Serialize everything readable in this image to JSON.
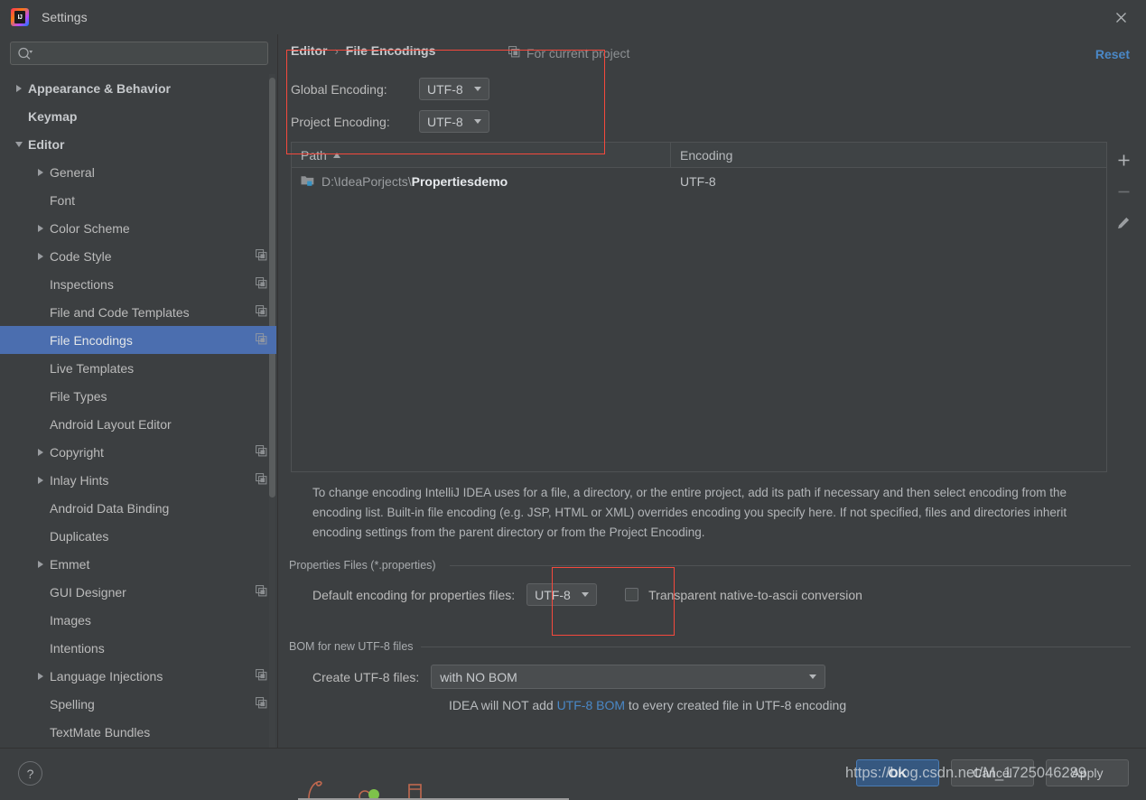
{
  "window": {
    "title": "Settings",
    "logo_icon": "intellij-idea-logo",
    "close_icon": "close-icon"
  },
  "search": {
    "value": "",
    "placeholder": "",
    "icon": "search-icon"
  },
  "sidebar": {
    "items": [
      {
        "label": "Appearance & Behavior",
        "indent": 0,
        "arrow": "right",
        "bold": true,
        "copy": false,
        "selected": false
      },
      {
        "label": "Keymap",
        "indent": 0,
        "arrow": "none",
        "bold": true,
        "copy": false,
        "selected": false
      },
      {
        "label": "Editor",
        "indent": 0,
        "arrow": "down",
        "bold": true,
        "copy": false,
        "selected": false
      },
      {
        "label": "General",
        "indent": 1,
        "arrow": "right",
        "bold": false,
        "copy": false,
        "selected": false
      },
      {
        "label": "Font",
        "indent": 1,
        "arrow": "none",
        "bold": false,
        "copy": false,
        "selected": false
      },
      {
        "label": "Color Scheme",
        "indent": 1,
        "arrow": "right",
        "bold": false,
        "copy": false,
        "selected": false
      },
      {
        "label": "Code Style",
        "indent": 1,
        "arrow": "right",
        "bold": false,
        "copy": true,
        "selected": false
      },
      {
        "label": "Inspections",
        "indent": 1,
        "arrow": "none",
        "bold": false,
        "copy": true,
        "selected": false
      },
      {
        "label": "File and Code Templates",
        "indent": 1,
        "arrow": "none",
        "bold": false,
        "copy": true,
        "selected": false
      },
      {
        "label": "File Encodings",
        "indent": 1,
        "arrow": "none",
        "bold": false,
        "copy": true,
        "selected": true
      },
      {
        "label": "Live Templates",
        "indent": 1,
        "arrow": "none",
        "bold": false,
        "copy": false,
        "selected": false
      },
      {
        "label": "File Types",
        "indent": 1,
        "arrow": "none",
        "bold": false,
        "copy": false,
        "selected": false
      },
      {
        "label": "Android Layout Editor",
        "indent": 1,
        "arrow": "none",
        "bold": false,
        "copy": false,
        "selected": false
      },
      {
        "label": "Copyright",
        "indent": 1,
        "arrow": "right",
        "bold": false,
        "copy": true,
        "selected": false
      },
      {
        "label": "Inlay Hints",
        "indent": 1,
        "arrow": "right",
        "bold": false,
        "copy": true,
        "selected": false
      },
      {
        "label": "Android Data Binding",
        "indent": 1,
        "arrow": "none",
        "bold": false,
        "copy": false,
        "selected": false
      },
      {
        "label": "Duplicates",
        "indent": 1,
        "arrow": "none",
        "bold": false,
        "copy": false,
        "selected": false
      },
      {
        "label": "Emmet",
        "indent": 1,
        "arrow": "right",
        "bold": false,
        "copy": false,
        "selected": false
      },
      {
        "label": "GUI Designer",
        "indent": 1,
        "arrow": "none",
        "bold": false,
        "copy": true,
        "selected": false
      },
      {
        "label": "Images",
        "indent": 1,
        "arrow": "none",
        "bold": false,
        "copy": false,
        "selected": false
      },
      {
        "label": "Intentions",
        "indent": 1,
        "arrow": "none",
        "bold": false,
        "copy": false,
        "selected": false
      },
      {
        "label": "Language Injections",
        "indent": 1,
        "arrow": "right",
        "bold": false,
        "copy": true,
        "selected": false
      },
      {
        "label": "Spelling",
        "indent": 1,
        "arrow": "none",
        "bold": false,
        "copy": true,
        "selected": false
      },
      {
        "label": "TextMate Bundles",
        "indent": 1,
        "arrow": "none",
        "bold": false,
        "copy": false,
        "selected": false
      }
    ]
  },
  "page": {
    "breadcrumb_root": "Editor",
    "breadcrumb_sep": "›",
    "breadcrumb_leaf": "File Encodings",
    "for_current_project": "For current project",
    "for_current_project_icon": "copy-icon",
    "reset_label": "Reset",
    "global_encoding_label": "Global Encoding:",
    "global_encoding_value": "UTF-8",
    "project_encoding_label": "Project Encoding:",
    "project_encoding_value": "UTF-8"
  },
  "table": {
    "columns": [
      "Path",
      "Encoding"
    ],
    "sort_column": "Path",
    "sort_direction": "asc",
    "rows": [
      {
        "path_prefix": "D:\\IdeaPorjects\\",
        "path_name": "Propertiesdemo",
        "encoding": "UTF-8",
        "icon": "folder-icon"
      }
    ],
    "toolbar": [
      {
        "name": "add-button",
        "icon": "plus-icon",
        "disabled": false
      },
      {
        "name": "remove-button",
        "icon": "minus-icon",
        "disabled": true
      },
      {
        "name": "edit-button",
        "icon": "pencil-icon",
        "disabled": false
      }
    ]
  },
  "description": "To change encoding IntelliJ IDEA uses for a file, a directory, or the entire project, add its path if necessary and then select encoding from the encoding list. Built-in file encoding (e.g. JSP, HTML or XML) overrides encoding you specify here. If not specified, files and directories inherit encoding settings from the parent directory or from the Project Encoding.",
  "properties_group": {
    "title": "Properties Files (*.properties)",
    "default_encoding_label": "Default encoding for properties files:",
    "default_encoding_value": "UTF-8",
    "transparent_checkbox_label": "Transparent native-to-ascii conversion",
    "transparent_checkbox_checked": false
  },
  "bom_group": {
    "title": "BOM for new UTF-8 files",
    "create_label": "Create UTF-8 files:",
    "create_value": "with NO BOM",
    "hint_before": "IDEA will NOT add ",
    "hint_link": "UTF-8 BOM",
    "hint_after": " to every created file in UTF-8 encoding"
  },
  "footer": {
    "help_label": "?",
    "ok_label": "OK",
    "cancel_label": "Cancel",
    "apply_label": "Apply"
  },
  "watermark": "https://blog.csdn.net/M_1725046289",
  "colors": {
    "background": "#3c3f41",
    "selection": "#4b6eaf",
    "link": "#4a88c7",
    "annotation": "#f5493d",
    "primary_button": "#365880"
  }
}
